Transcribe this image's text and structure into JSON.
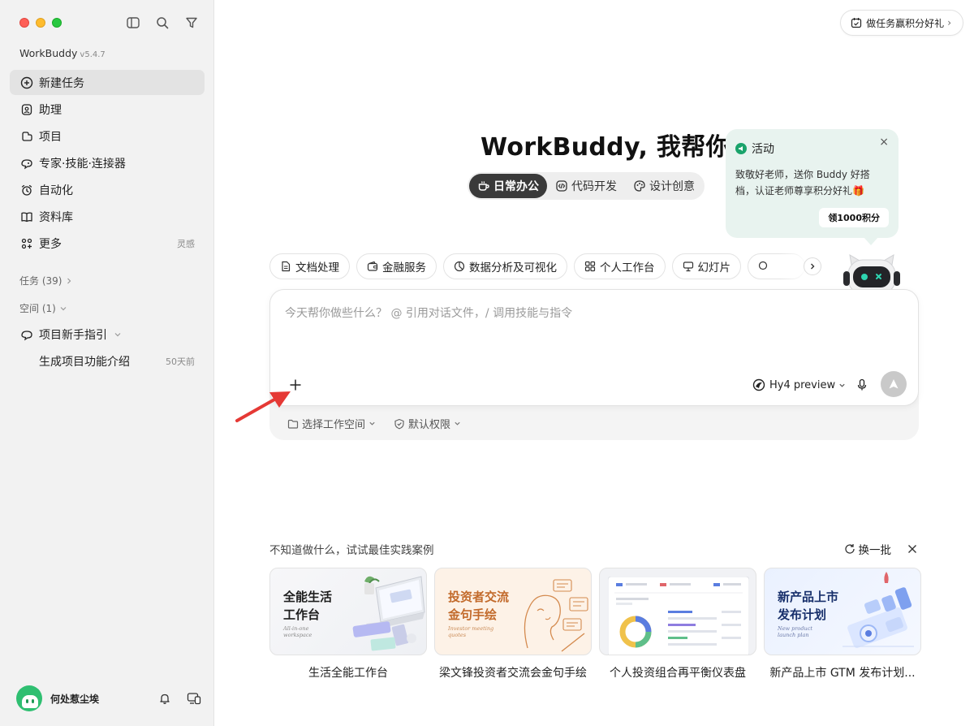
{
  "app": {
    "name": "WorkBuddy",
    "version": "v5.4.7"
  },
  "sidebar": {
    "nav": [
      {
        "label": "新建任务",
        "icon": "new-task-icon",
        "active": true
      },
      {
        "label": "助理",
        "icon": "assistant-icon"
      },
      {
        "label": "项目",
        "icon": "project-icon"
      },
      {
        "label": "专家·技能·连接器",
        "icon": "expert-icon"
      },
      {
        "label": "自动化",
        "icon": "alarm-icon"
      },
      {
        "label": "资料库",
        "icon": "book-icon"
      },
      {
        "label": "更多",
        "icon": "more-icon",
        "extra": "灵感"
      }
    ],
    "tasks_label": "任务 (39)",
    "spaces_label": "空间 (1)",
    "project": {
      "label": "项目新手指引",
      "sub_label": "生成项目功能介绍",
      "sub_time": "50天前"
    },
    "user": {
      "name": "何处惹尘埃"
    }
  },
  "header": {
    "promo_label": "做任务赢积分好礼",
    "promo_chevron": "›"
  },
  "main": {
    "headline": "WorkBuddy, 我帮你",
    "modes": [
      {
        "label": "日常办公",
        "icon": "coffee-icon",
        "active": true
      },
      {
        "label": "代码开发",
        "icon": "code-icon"
      },
      {
        "label": "设计创意",
        "icon": "palette-icon"
      }
    ],
    "chips": [
      {
        "label": "文档处理",
        "icon": "document-icon"
      },
      {
        "label": "金融服务",
        "icon": "wallet-icon"
      },
      {
        "label": "数据分析及可视化",
        "icon": "pie-chart-icon"
      },
      {
        "label": "个人工作台",
        "icon": "grid-icon"
      },
      {
        "label": "幻灯片",
        "icon": "presentation-icon"
      }
    ],
    "composer": {
      "placeholder": "今天帮你做些什么？ @ 引用对话文件，/ 调用技能与指令",
      "model": "Hy4 preview",
      "workspace_label": "选择工作空间",
      "permission_label": "默认权限"
    },
    "activity": {
      "title": "活动",
      "text": "致敬好老师，送你 Buddy 好搭档，认证老师尊享积分好礼🎁",
      "button": "领1000积分",
      "close": "×"
    },
    "cases": {
      "title": "不知道做什么，试试最佳实践案例",
      "refresh": "换一批",
      "items": [
        {
          "caption": "生活全能工作台",
          "thumb_title_1": "全能生活",
          "thumb_title_2": "工作台",
          "thumb_sub_1": "All-in-one",
          "thumb_sub_2": "workspace"
        },
        {
          "caption": "梁文锋投资者交流会金句手绘",
          "thumb_title_1": "投资者交流",
          "thumb_title_2": "金句手绘",
          "thumb_sub_1": "Investor meeting",
          "thumb_sub_2": "quotes"
        },
        {
          "caption": "个人投资组合再平衡仪表盘"
        },
        {
          "caption": "新产品上市 GTM 发布计划...",
          "thumb_title_1": "新产品上市",
          "thumb_title_2": "发布计划",
          "thumb_sub_1": "New product",
          "thumb_sub_2": "launch plan"
        }
      ]
    }
  },
  "colors": {
    "sidebar_bg": "#f2f2f2",
    "accent_green": "#1aa36b",
    "active_tab": "#3a3a3a",
    "arrow_red": "#e53935"
  }
}
